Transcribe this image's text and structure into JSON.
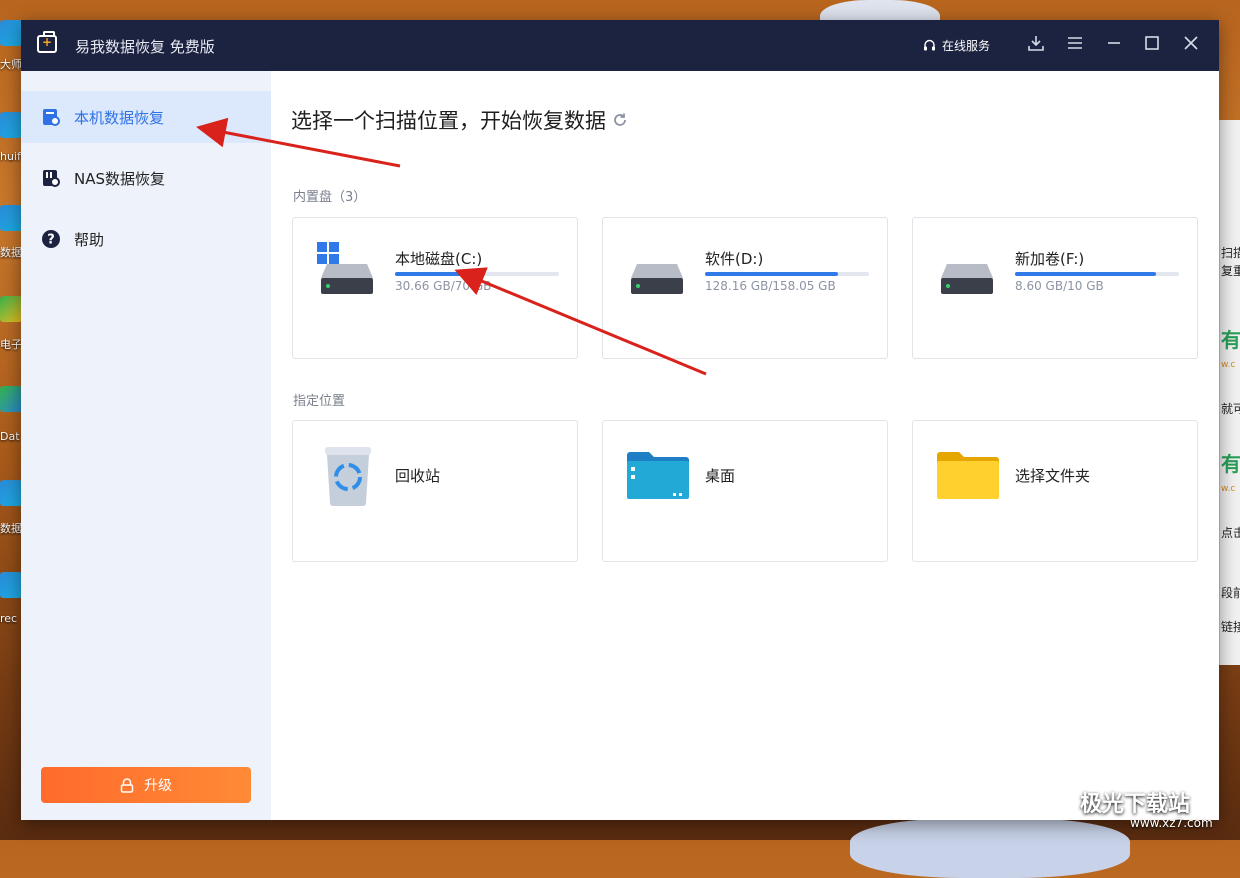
{
  "window": {
    "title": "易我数据恢复 免费版",
    "online_service": "在线服务"
  },
  "sidebar": {
    "items": [
      {
        "label": "本机数据恢复",
        "active": true
      },
      {
        "label": "NAS数据恢复",
        "active": false
      },
      {
        "label": "帮助",
        "active": false
      }
    ],
    "upgrade_label": "升级"
  },
  "main": {
    "title": "选择一个扫描位置，开始恢复数据",
    "internal_section": "内置盘（3）",
    "location_section": "指定位置",
    "drives": [
      {
        "name": "本地磁盘(C:)",
        "size": "30.66 GB/70 GB",
        "used_fraction": 0.438
      },
      {
        "name": "软件(D:)",
        "size": "128.16 GB/158.05 GB",
        "used_fraction": 0.811
      },
      {
        "name": "新加卷(F:)",
        "size": "8.60 GB/10 GB",
        "used_fraction": 0.86
      }
    ],
    "locations": [
      {
        "name": "回收站"
      },
      {
        "name": "桌面"
      },
      {
        "name": "选择文件夹"
      }
    ]
  },
  "desktop": {
    "labels": [
      "大师\n恢复软",
      "huifu",
      "数据\n专业",
      "电子\n恢复",
      "Dat",
      "数据",
      "rec"
    ],
    "right_strip": [
      "扫描",
      "复重",
      "就可",
      "点击",
      "段前",
      "链接"
    ]
  },
  "watermark": {
    "brand": "极光下载站",
    "url": "www.xz7.com"
  },
  "colors": {
    "titlebar": "#1c2340",
    "accent": "#2e72e6",
    "upgrade": "#ff7a30",
    "arrow": "#d9221c"
  }
}
